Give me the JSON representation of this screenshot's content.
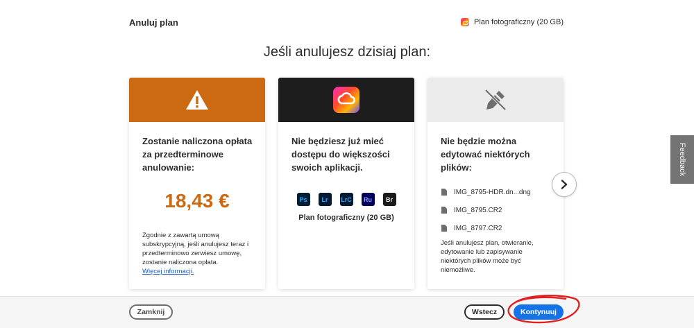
{
  "header": {
    "title": "Anuluj plan",
    "plan_badge": "Plan fotograficzny (20 GB)"
  },
  "heading": "Jeśli anulujesz dzisiaj plan:",
  "cards": [
    {
      "icon": "warning-icon",
      "color": "#cb6a12",
      "title": "Zostanie naliczona opłata za przedterminowe anulowanie:",
      "price": "18,43 €",
      "note": "Zgodnie z zawartą umową subskrypcyjną, jeśli anulujesz teraz i przedterminowo zerwiesz umowę, zostanie naliczona opłata.",
      "link": "Więcej informacji."
    },
    {
      "icon": "creative-cloud-icon",
      "color": "#1d1d1d",
      "title": "Nie będziesz już mieć dostępu do większości swoich aplikacji.",
      "apps": [
        "Ps",
        "Lr",
        "LrC",
        "Ru",
        "Br"
      ],
      "plan": "Plan fotograficzny (20 GB)"
    },
    {
      "icon": "edit-disabled-icon",
      "color": "#ebebeb",
      "title": "Nie będzie można edytować niektórych plików:",
      "files": [
        "IMG_8795-HDR.dn...dng",
        "IMG_8795.CR2",
        "IMG_8797.CR2"
      ],
      "note": "Jeśli anulujesz plan, otwieranie, edytowanie lub zapisywanie niektórych plików może być niemożliwe."
    }
  ],
  "feedback": "Feedback",
  "footer": {
    "close": "Zamknij",
    "back": "Wstecz",
    "continue": "Kontynuuj"
  },
  "colors": {
    "accent": "#1473e6",
    "warning": "#cb6a12",
    "annotation": "#e02020"
  }
}
